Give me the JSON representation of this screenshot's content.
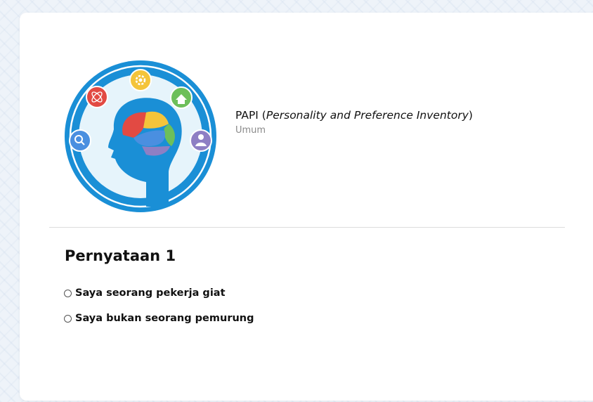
{
  "test": {
    "title_prefix": "PAPI (",
    "title_italic": "Personality and Preference Inventory",
    "title_suffix": ")",
    "category": "Umum"
  },
  "question": {
    "heading": "Pernyataan 1",
    "options": [
      {
        "label": "Saya seorang pekerja giat",
        "selected": false
      },
      {
        "label": "Saya bukan seorang pemurung",
        "selected": false
      }
    ]
  },
  "colors": {
    "logo_blue": "#1a8fd6",
    "logo_inner": "#e6f4fb",
    "brain_red": "#e24a43",
    "brain_yellow": "#f4c43a",
    "brain_blue": "#4a8fe0",
    "brain_green": "#6dbf5a",
    "brain_purple": "#8e7fc4"
  }
}
